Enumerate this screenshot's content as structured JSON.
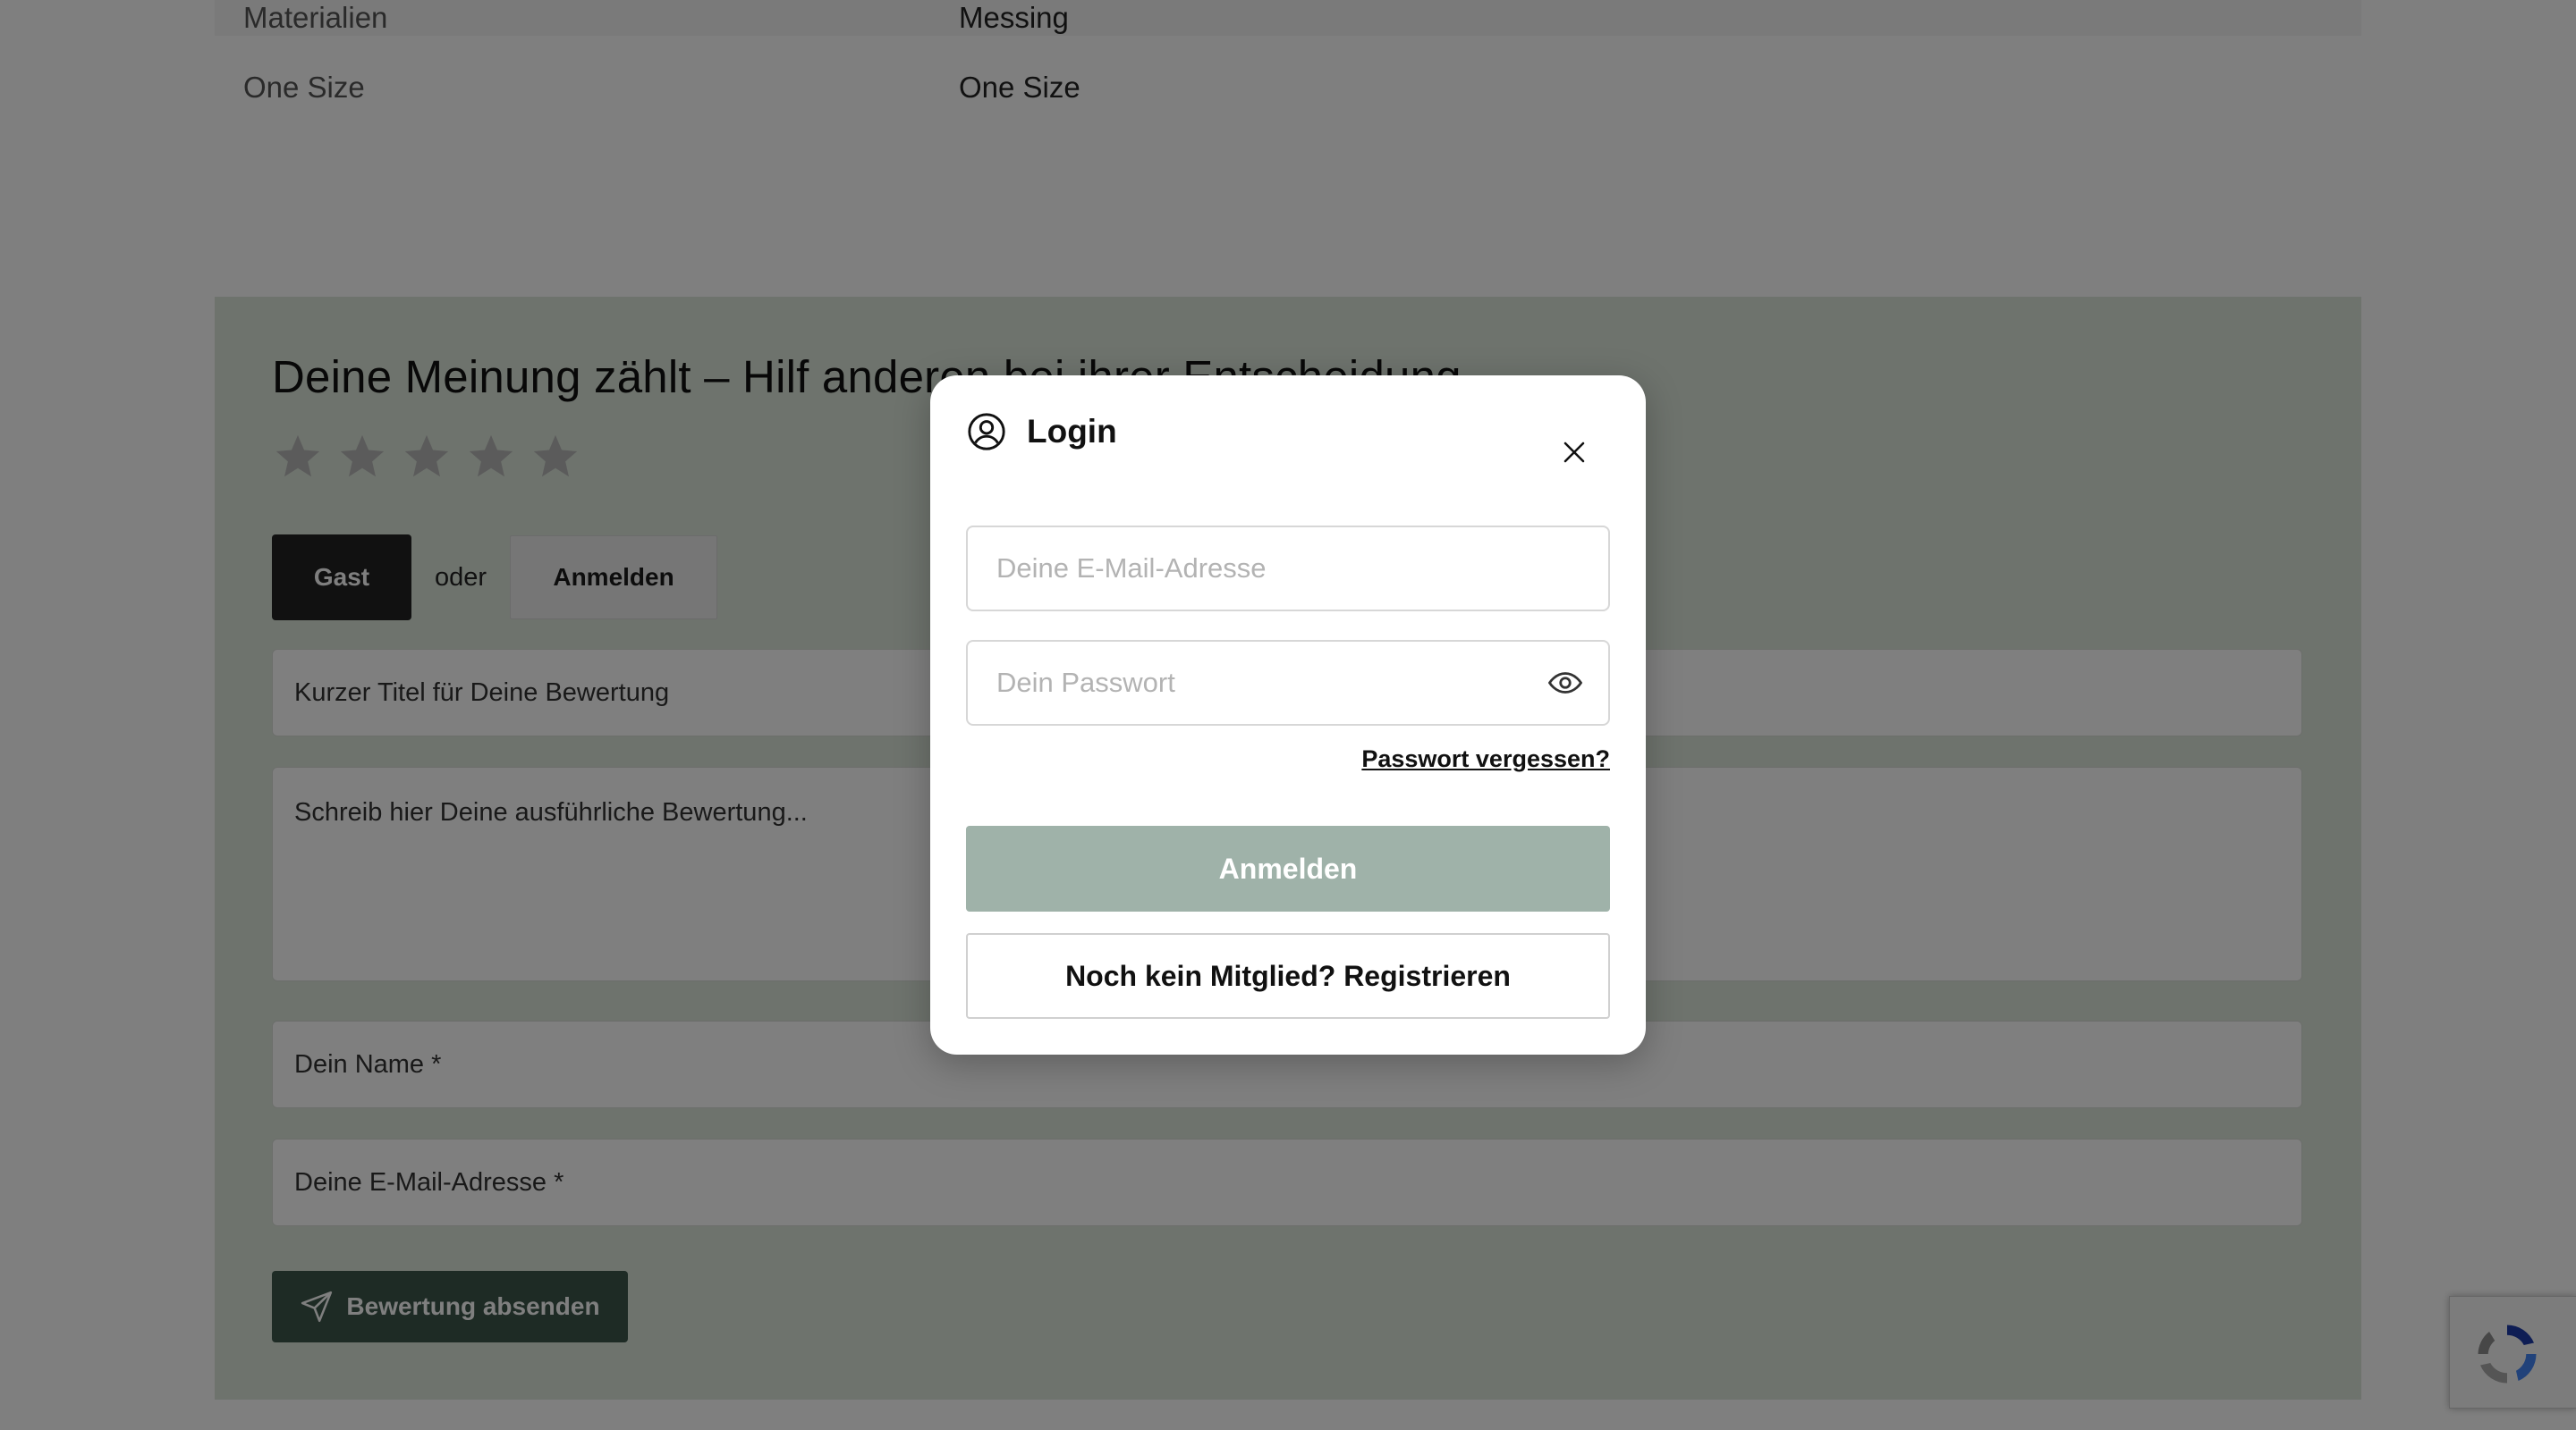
{
  "colors": {
    "review_bg": "#dce6da",
    "guest_button": "#222222",
    "submit_button": "#3c574a",
    "login_button": "#9fb2a9",
    "overlay": "rgba(0,0,0,0.5)",
    "star_empty": "#b7b7b7"
  },
  "specs": [
    {
      "label": "Materialien",
      "value": "Messing"
    },
    {
      "label": "One Size",
      "value": "One Size"
    }
  ],
  "review": {
    "title": "Deine Meinung zählt – Hilf anderen bei ihrer Entscheidung",
    "rating": {
      "value": 0,
      "max": 5,
      "icon": "star-icon"
    },
    "guest_label": "Gast",
    "or_label": "oder",
    "signin_label": "Anmelden",
    "title_placeholder": "Kurzer Titel für Deine Bewertung",
    "body_placeholder": "Schreib hier Deine ausführliche Bewertung...",
    "name_placeholder": "Dein Name *",
    "email_placeholder": "Deine E-Mail-Adresse *",
    "submit_label": "Bewertung absenden",
    "submit_icon": "send-icon"
  },
  "modal": {
    "title": "Login",
    "title_icon": "user-circle-icon",
    "close_icon": "close-icon",
    "email_placeholder": "Deine E-Mail-Adresse",
    "password_placeholder": "Dein Passwort",
    "password_toggle_icon": "eye-icon",
    "forgot_label": "Passwort vergessen?",
    "login_label": "Anmelden",
    "register_label": "Noch kein Mitglied? Registrieren"
  },
  "recaptcha": {
    "icon": "recaptcha-icon"
  }
}
